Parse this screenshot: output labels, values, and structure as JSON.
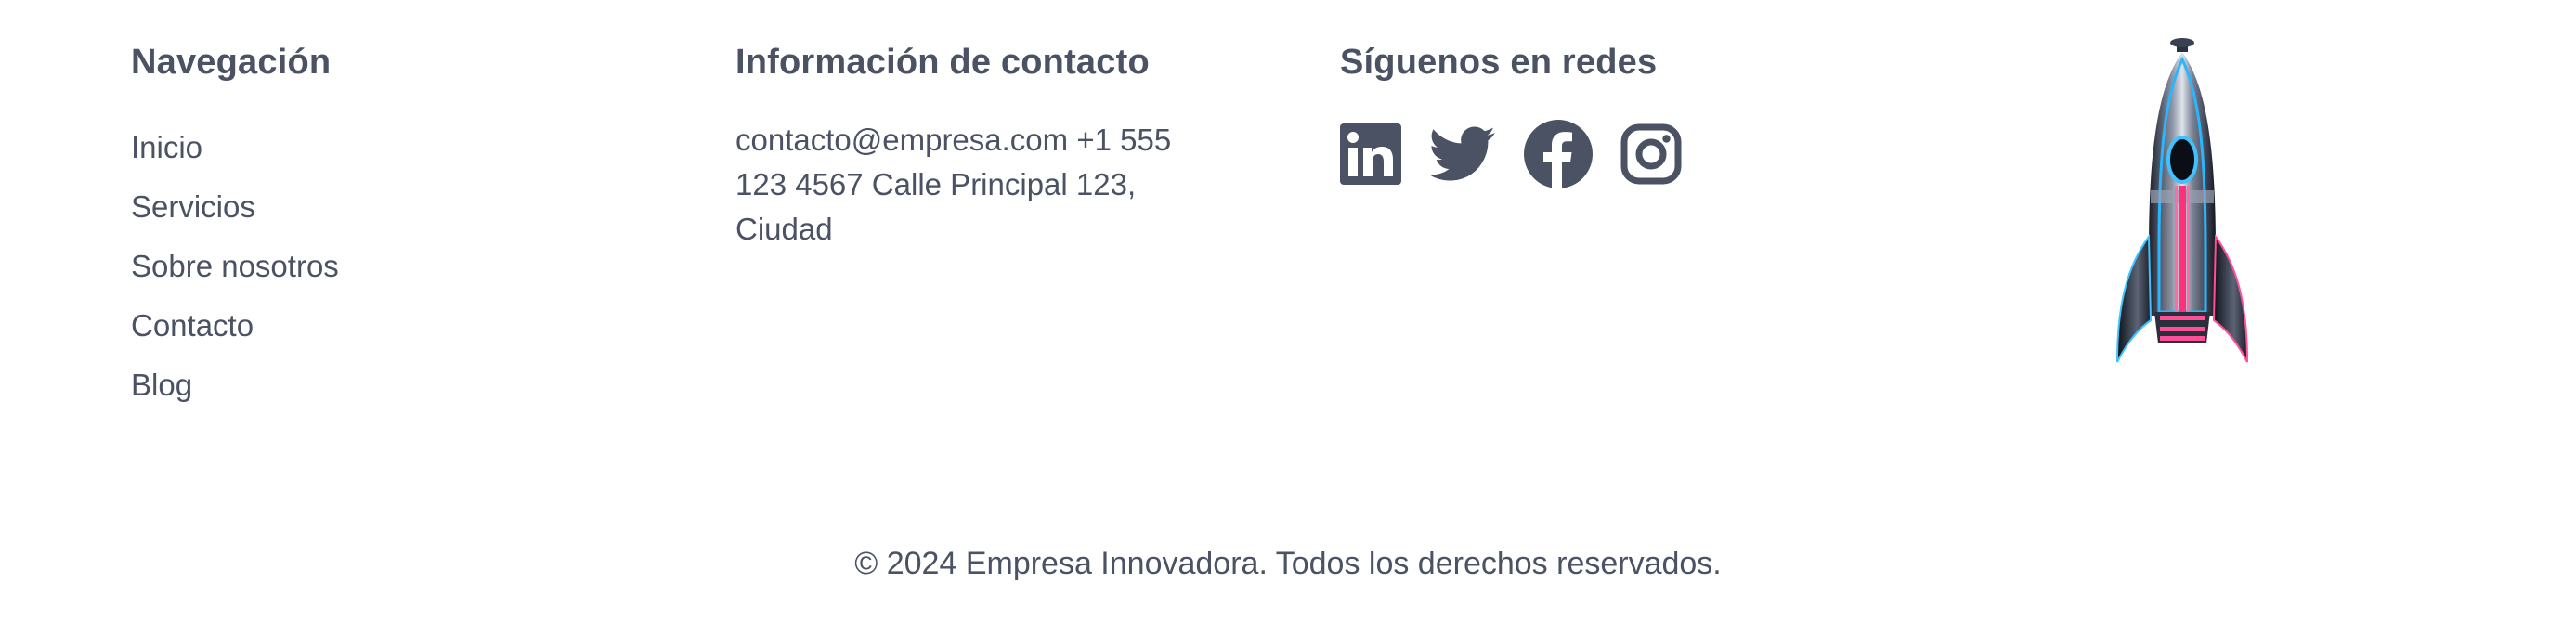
{
  "navigation": {
    "heading": "Navegación",
    "items": [
      {
        "label": "Inicio"
      },
      {
        "label": "Servicios"
      },
      {
        "label": "Sobre nosotros"
      },
      {
        "label": "Contacto"
      },
      {
        "label": "Blog"
      }
    ]
  },
  "contact": {
    "heading": "Información de contacto",
    "text": "contacto@empresa.com +1 555 123 4567 Calle Principal 123, Ciudad"
  },
  "social": {
    "heading": "Síguenos en redes",
    "icons": [
      "linkedin-icon",
      "twitter-icon",
      "facebook-icon",
      "instagram-icon"
    ],
    "icon_color": "#4a5263"
  },
  "footer": {
    "copyright": "© 2024 Empresa Innovadora. Todos los derechos reservados."
  }
}
